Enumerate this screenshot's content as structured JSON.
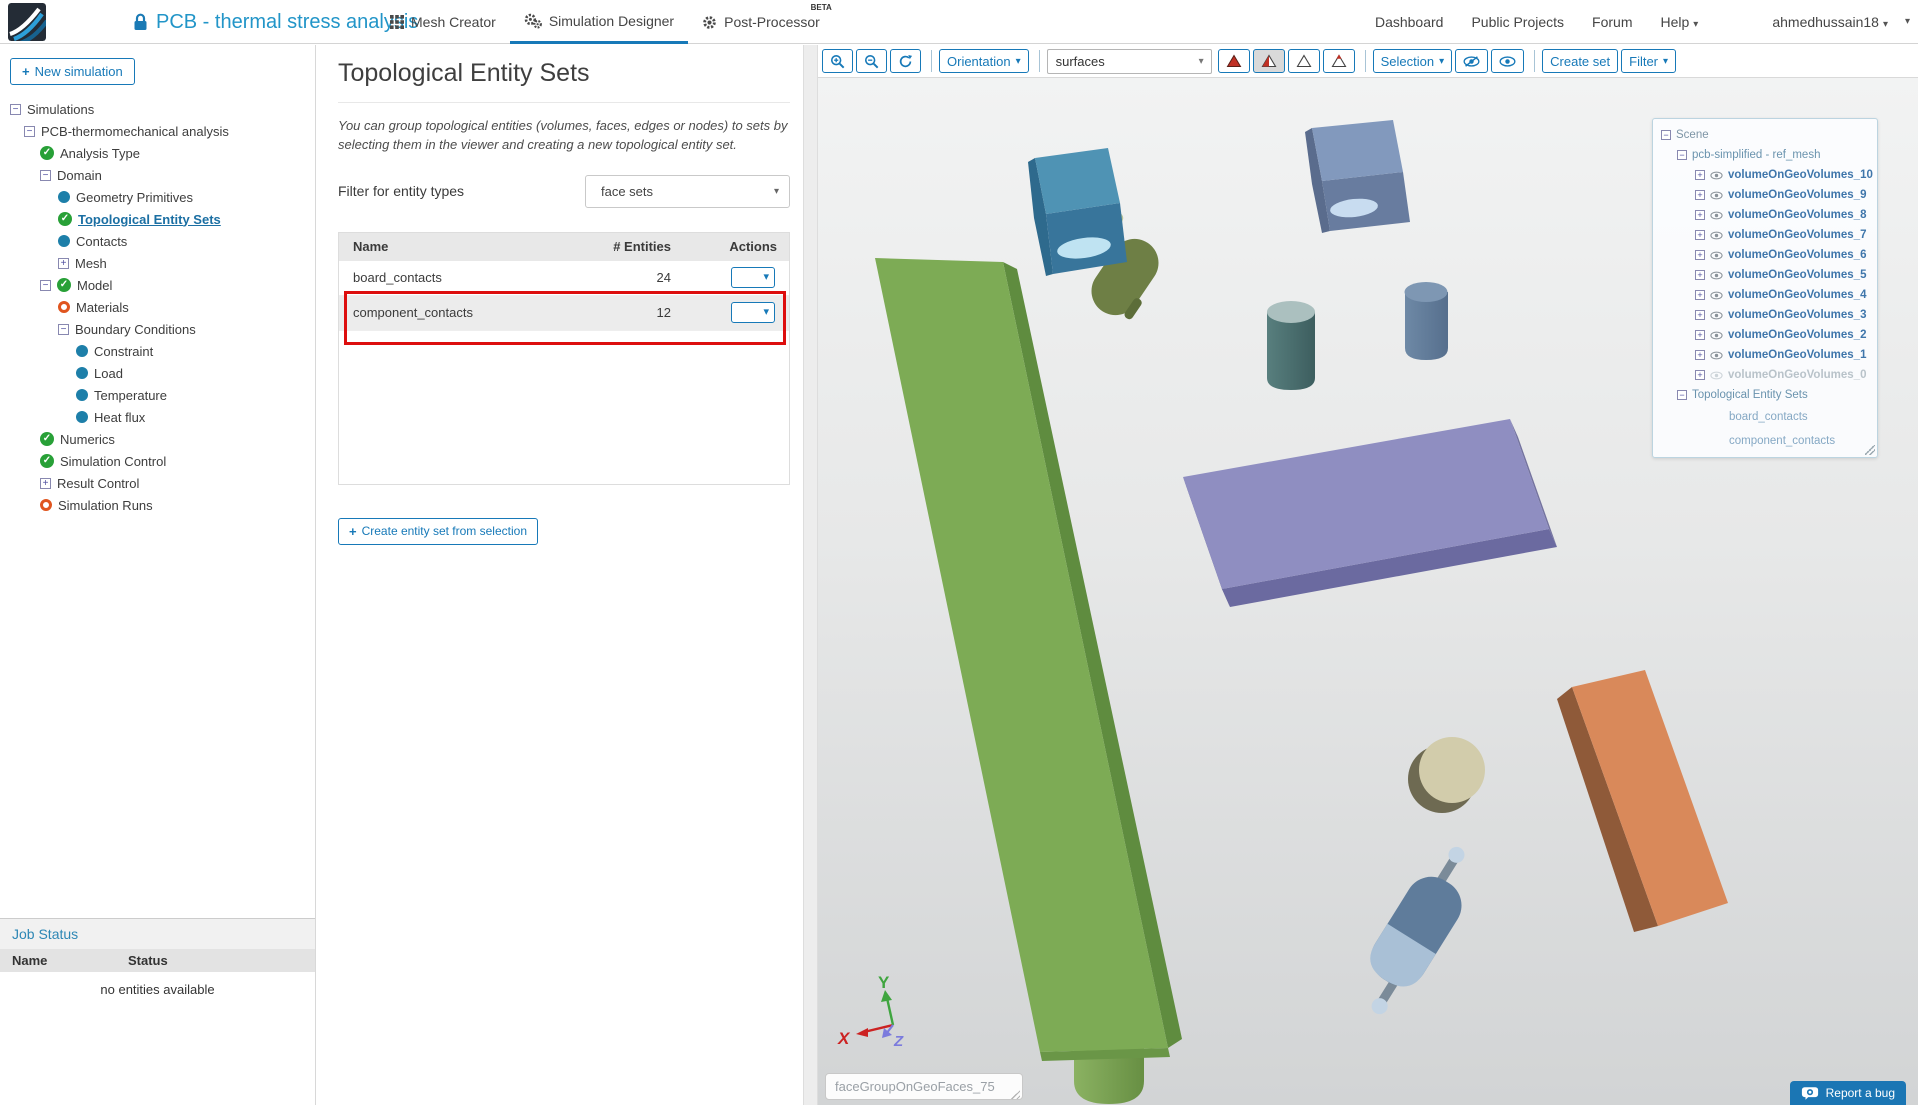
{
  "header": {
    "project_title": "PCB - thermal stress analysis",
    "tabs": [
      {
        "label": "Mesh Creator",
        "icon": "grid-icon"
      },
      {
        "label": "Simulation Designer",
        "icon": "gears-icon",
        "active": true
      },
      {
        "label": "Post-Processor",
        "icon": "gear-icon",
        "badge": "BETA"
      }
    ],
    "nav": [
      {
        "label": "Dashboard"
      },
      {
        "label": "Public Projects"
      },
      {
        "label": "Forum"
      },
      {
        "label": "Help"
      }
    ],
    "user": "ahmedhussain18"
  },
  "sidebar": {
    "new_simulation_label": "New simulation",
    "tree": [
      {
        "label": "Simulations",
        "icon": "collapse",
        "level": 0
      },
      {
        "label": "PCB-thermomechanical analysis",
        "icon": "collapse",
        "level": 1
      },
      {
        "label": "Analysis Type",
        "icon": "check",
        "level": 2
      },
      {
        "label": "Domain",
        "icon": "collapse",
        "level": 2
      },
      {
        "label": "Geometry Primitives",
        "icon": "dot",
        "level": 3
      },
      {
        "label": "Topological Entity Sets",
        "icon": "check",
        "level": 3,
        "selected": true
      },
      {
        "label": "Contacts",
        "icon": "dot",
        "level": 3
      },
      {
        "label": "Mesh",
        "icon": "expand",
        "level": 3
      },
      {
        "label": "Model",
        "icon": "collapse+check",
        "level": 2
      },
      {
        "label": "Materials",
        "icon": "ring",
        "level": 3
      },
      {
        "label": "Boundary Conditions",
        "icon": "collapse",
        "level": 3
      },
      {
        "label": "Constraint",
        "icon": "dot",
        "level": 4
      },
      {
        "label": "Load",
        "icon": "dot",
        "level": 4
      },
      {
        "label": "Temperature",
        "icon": "dot",
        "level": 4
      },
      {
        "label": "Heat flux",
        "icon": "dot",
        "level": 4
      },
      {
        "label": "Numerics",
        "icon": "check",
        "level": 2
      },
      {
        "label": "Simulation Control",
        "icon": "check",
        "level": 2
      },
      {
        "label": "Result Control",
        "icon": "expand",
        "level": 2
      },
      {
        "label": "Simulation Runs",
        "icon": "ring",
        "level": 2
      }
    ],
    "job_status": {
      "title": "Job Status",
      "columns": {
        "name": "Name",
        "status": "Status"
      },
      "empty_text": "no entities available"
    }
  },
  "panel": {
    "title": "Topological Entity Sets",
    "description": "You can group topological entities (volumes, faces, edges or nodes) to sets by selecting them in the viewer and creating a new topological entity set.",
    "filter_label": "Filter for entity types",
    "filter_value": "face sets",
    "table": {
      "columns": {
        "name": "Name",
        "entities": "# Entities",
        "actions": "Actions"
      },
      "rows": [
        {
          "name": "board_contacts",
          "entities": "24"
        },
        {
          "name": "component_contacts",
          "entities": "12",
          "highlighted": true
        }
      ]
    },
    "create_button_label": "Create entity set from selection",
    "create_button_plus": "+"
  },
  "viewer": {
    "toolbar": {
      "orientation_label": "Orientation",
      "display_mode_value": "surfaces",
      "selection_label": "Selection",
      "create_set_label": "Create set",
      "filter_label": "Filter"
    },
    "scene_tree": {
      "root": "Scene",
      "mesh": "pcb-simplified - ref_mesh",
      "volumes": [
        {
          "label": "volumeOnGeoVolumes_10"
        },
        {
          "label": "volumeOnGeoVolumes_9"
        },
        {
          "label": "volumeOnGeoVolumes_8"
        },
        {
          "label": "volumeOnGeoVolumes_7"
        },
        {
          "label": "volumeOnGeoVolumes_6"
        },
        {
          "label": "volumeOnGeoVolumes_5"
        },
        {
          "label": "volumeOnGeoVolumes_4"
        },
        {
          "label": "volumeOnGeoVolumes_3"
        },
        {
          "label": "volumeOnGeoVolumes_2"
        },
        {
          "label": "volumeOnGeoVolumes_1"
        },
        {
          "label": "volumeOnGeoVolumes_0",
          "disabled": true
        }
      ],
      "sets_group": "Topological Entity Sets",
      "sets": [
        {
          "label": "board_contacts"
        },
        {
          "label": "component_contacts"
        }
      ]
    },
    "axis": {
      "x": "X",
      "y": "Y",
      "z": "Z"
    },
    "selection_input_value": "faceGroupOnGeoFaces_75",
    "report_bug_label": "Report a bug",
    "objects": [
      {
        "name": "pcb-board",
        "color": "#7dab55"
      },
      {
        "name": "teal-component-box",
        "color": "#4f93b4"
      },
      {
        "name": "olive-capsule",
        "color": "#6e7f45"
      },
      {
        "name": "steel-blue-box",
        "color": "#8299bd"
      },
      {
        "name": "dark-teal-cylinder",
        "color": "#4d7171"
      },
      {
        "name": "steel-blue-cylinder",
        "color": "#64809e"
      },
      {
        "name": "purple-box",
        "color": "#8f8ec1"
      },
      {
        "name": "khaki-cylinder",
        "color": "#d2ccab"
      },
      {
        "name": "blue-capsule",
        "color": "#5f7c9b"
      },
      {
        "name": "orange-box",
        "color": "#d9895a"
      }
    ]
  },
  "colors": {
    "accent_blue": "#1779b8",
    "title_blue": "#2295c8",
    "highlight_red": "#dd0e0e",
    "check_green": "#28a037",
    "node_blue": "#1d7fa9",
    "warn_orange": "#e0551f"
  }
}
